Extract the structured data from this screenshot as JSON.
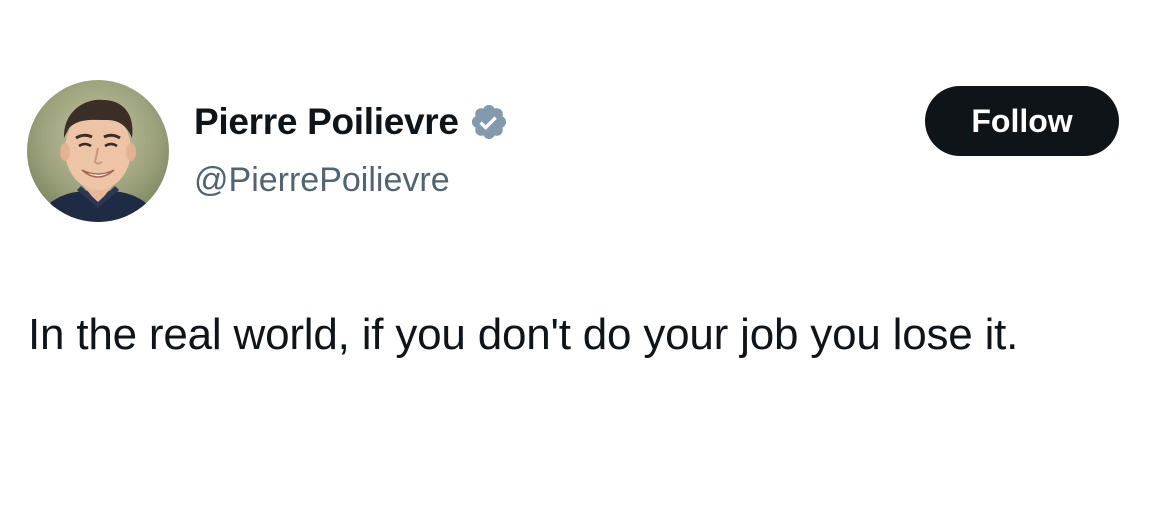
{
  "author": {
    "display_name": "Pierre Poilievre",
    "handle": "@PierrePoilievre",
    "verified_icon": "verified-badge-icon",
    "verified_color": "#829aab"
  },
  "actions": {
    "follow_label": "Follow"
  },
  "tweet": {
    "text": "In the real world, if you don't do your job you lose it."
  },
  "colors": {
    "text_primary": "#0f1419",
    "text_secondary": "#536471",
    "button_bg": "#0f1419",
    "button_text": "#ffffff"
  }
}
